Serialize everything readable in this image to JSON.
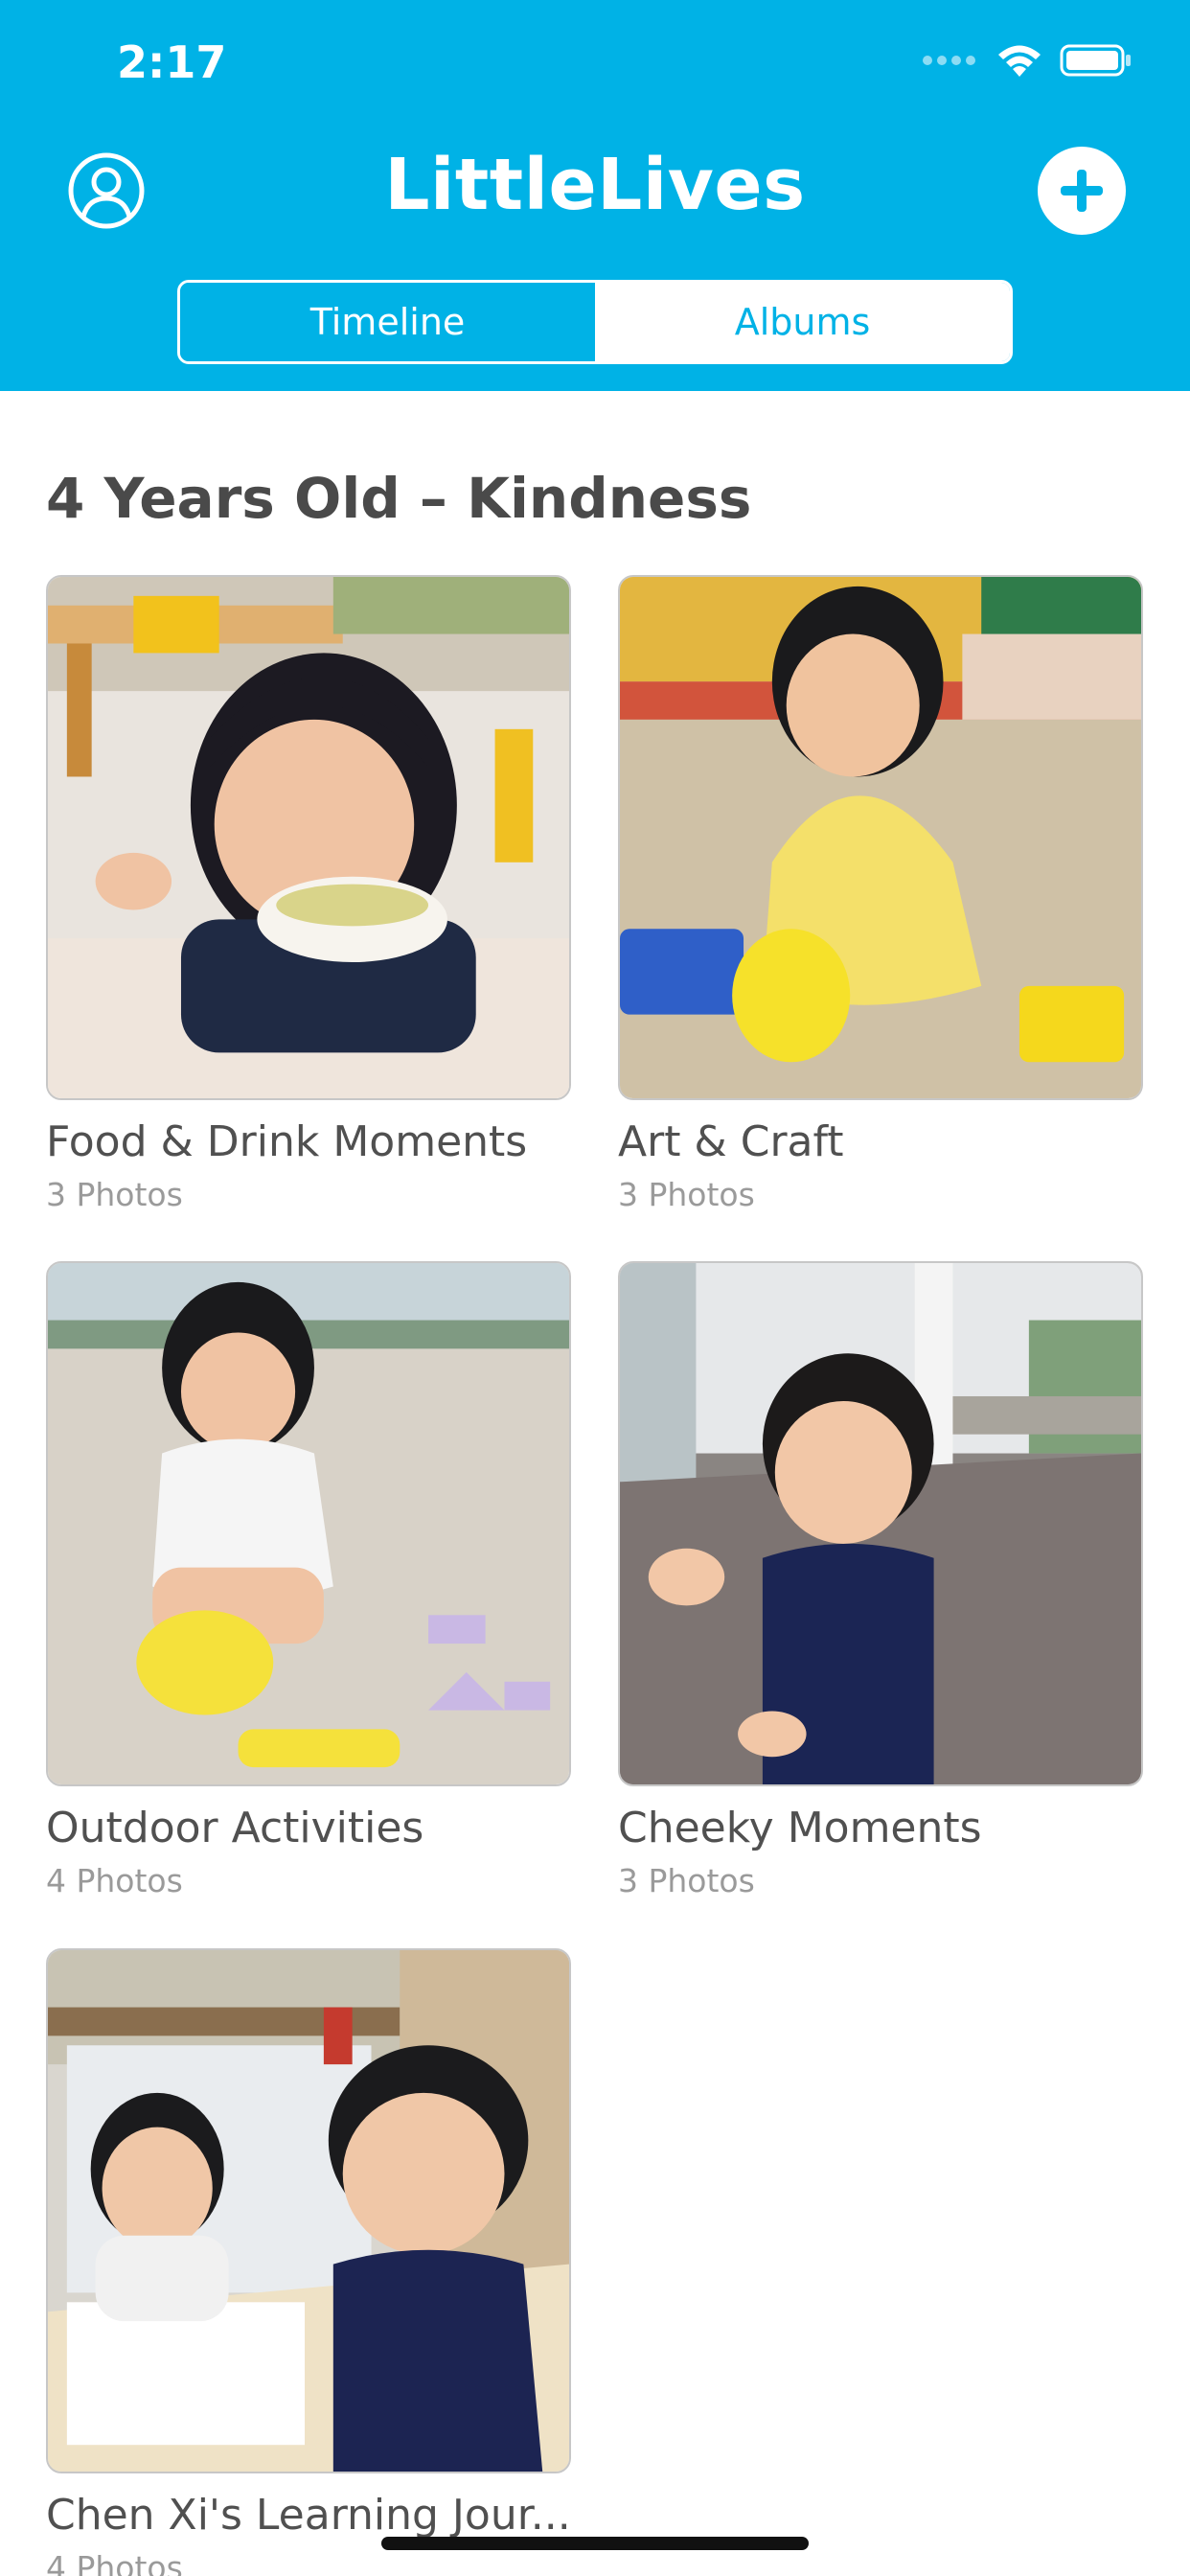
{
  "status_bar": {
    "time": "2:17"
  },
  "header": {
    "title": "LittleLives",
    "tabs": [
      {
        "label": "Timeline"
      },
      {
        "label": "Albums"
      }
    ]
  },
  "section": {
    "title": "4 Years Old – Kindness"
  },
  "albums": [
    {
      "name": "Food & Drink Moments",
      "count": "3 Photos"
    },
    {
      "name": "Art & Craft",
      "count": "3 Photos"
    },
    {
      "name": "Outdoor Activities",
      "count": "4 Photos"
    },
    {
      "name": "Cheeky Moments",
      "count": "3 Photos"
    },
    {
      "name": "Chen Xi's Learning Jour...",
      "count": "4 Photos"
    }
  ],
  "icons": {
    "profile": "person-circle-icon",
    "add": "plus-circle-icon",
    "wifi": "wifi-icon",
    "battery": "battery-icon"
  },
  "colors": {
    "brand": "#00b2e6",
    "title_text": "#4a4a4a",
    "subtitle_text": "#9a9a9a"
  }
}
